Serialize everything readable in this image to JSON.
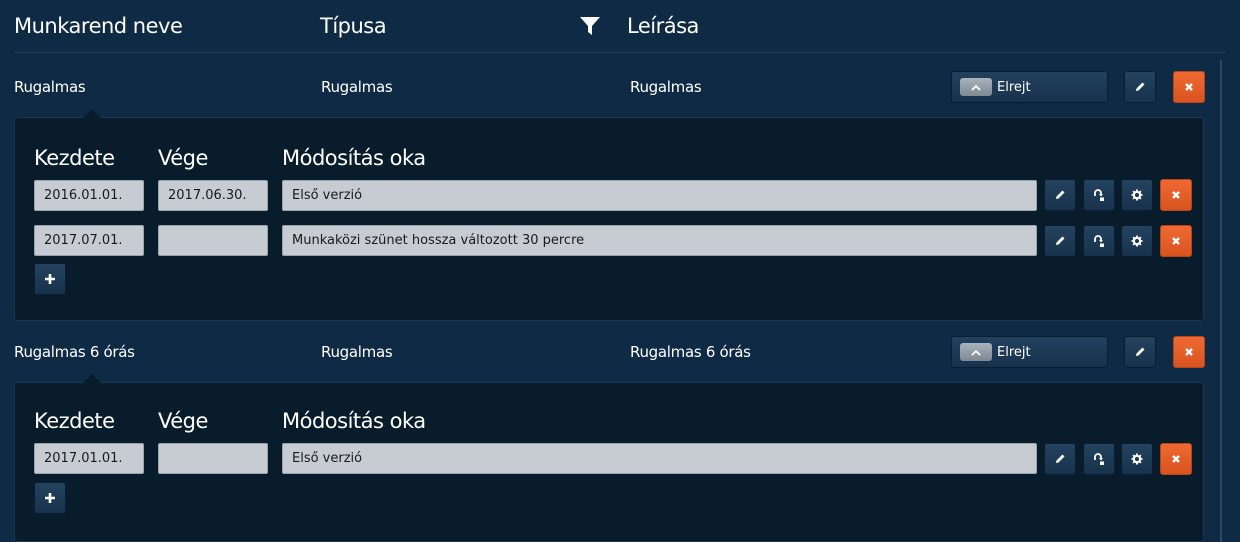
{
  "columns": {
    "name": "Munkarend neve",
    "type": "Típusa",
    "description": "Leírása"
  },
  "icons": {
    "filter": "filter-icon",
    "chevron_up": "chevron-up-icon",
    "edit": "pencil-icon",
    "delete": "close-icon",
    "clone": "copy-arrow-icon",
    "settings": "gear-icon",
    "add": "plus-icon"
  },
  "colors": {
    "background": "#0e2a45",
    "panel": "#081c2b",
    "danger": "#e25d26",
    "field": "#c6ccd2"
  },
  "rows": [
    {
      "name": "Rugalmas",
      "type": "Rugalmas",
      "description": "Rugalmas",
      "toggle_label": "Elrejt",
      "sub_headers": {
        "start": "Kezdete",
        "end": "Vége",
        "reason": "Módosítás oka"
      },
      "versions": [
        {
          "start": "2016.01.01.",
          "end": "2017.06.30.",
          "reason": "Első verzió"
        },
        {
          "start": "2017.07.01.",
          "end": "",
          "reason": "Munkaközi szünet hossza változott 30 percre"
        }
      ]
    },
    {
      "name": "Rugalmas 6 órás",
      "type": "Rugalmas",
      "description": "Rugalmas 6 órás",
      "toggle_label": "Elrejt",
      "sub_headers": {
        "start": "Kezdete",
        "end": "Vége",
        "reason": "Módosítás oka"
      },
      "versions": [
        {
          "start": "2017.01.01.",
          "end": "",
          "reason": "Első verzió"
        }
      ]
    }
  ]
}
